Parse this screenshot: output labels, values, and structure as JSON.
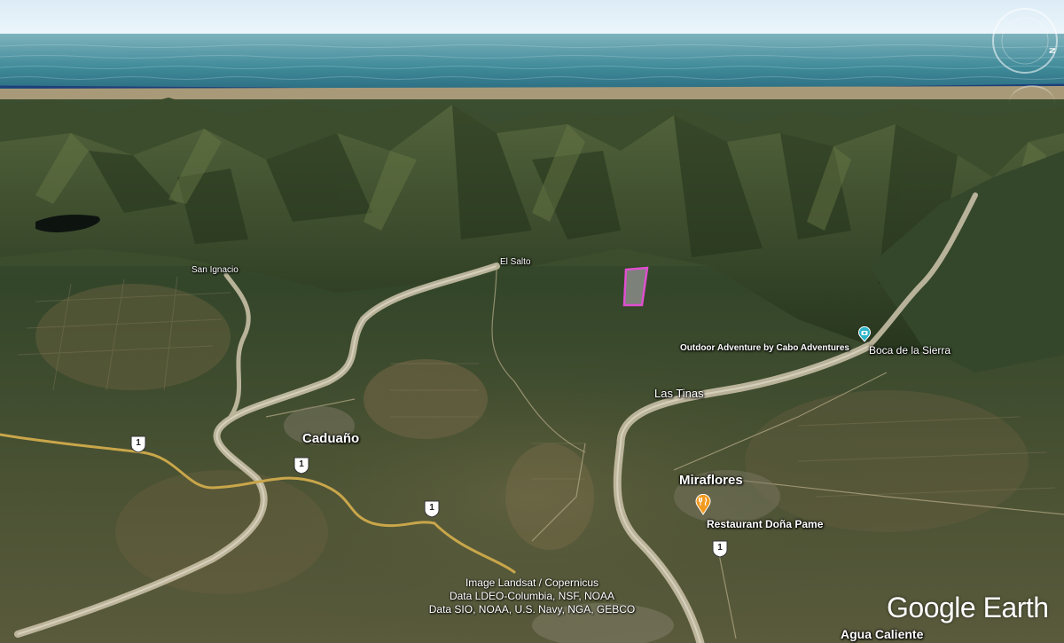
{
  "map": {
    "view": "3D tilted satellite terrain",
    "places": {
      "san_ignacio": "San Ignacio",
      "el_salto": "El Salto",
      "caduano": "Caduaño",
      "las_tinas": "Las Tinas",
      "miraflores": "Miraflores",
      "boca_de_la_sierra": "Boca de la Sierra",
      "agua_caliente": "Agua Caliente"
    },
    "pois": {
      "outdoor_adventure": {
        "label": "Outdoor Adventure by Cabo Adventures",
        "icon": "camera-pin-icon",
        "color": "#2bb5c9"
      },
      "restaurant": {
        "label": "Restaurant Doña Pame",
        "icon": "fork-knife-pin-icon",
        "color": "#f29a1f"
      }
    },
    "highway_shields": [
      "1",
      "1",
      "1",
      "1"
    ],
    "polygon_outline_color": "#e04fd0"
  },
  "attribution": {
    "line1": "Image Landsat / Copernicus",
    "line2": "Data LDEO-Columbia, NSF, NOAA",
    "line3": "Data SIO, NOAA, U.S. Navy, NGA, GEBCO"
  },
  "logo": "Google Earth",
  "compass_letter": "N"
}
